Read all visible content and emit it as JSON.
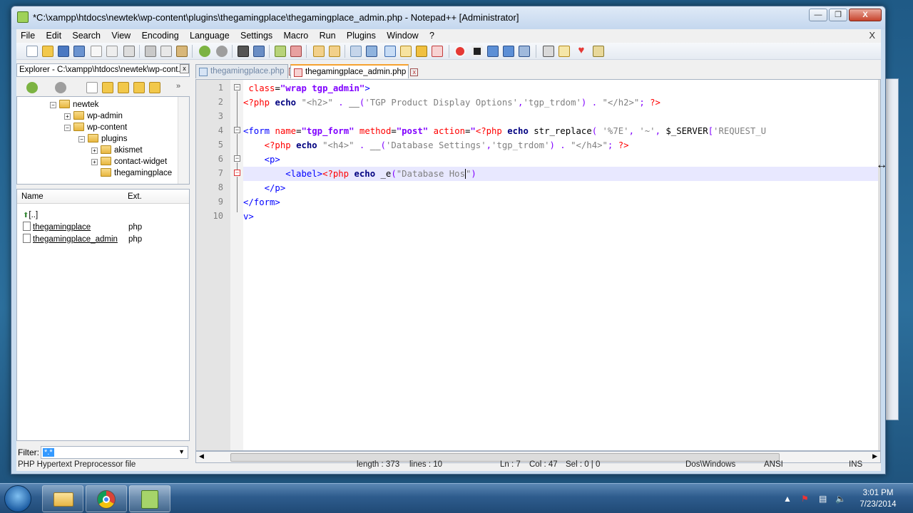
{
  "window": {
    "title": "*C:\\xampp\\htdocs\\newtek\\wp-content\\plugins\\thegamingplace\\thegamingplace_admin.php - Notepad++ [Administrator]",
    "min_label": "—",
    "max_label": "❐",
    "close_label": "X"
  },
  "menu": {
    "items": [
      "File",
      "Edit",
      "Search",
      "View",
      "Encoding",
      "Language",
      "Settings",
      "Macro",
      "Run",
      "Plugins",
      "Window",
      "?"
    ],
    "close_label": "X"
  },
  "explorer": {
    "title": "Explorer - C:\\xampp\\htdocs\\newtek\\wp-cont...",
    "close_label": "x",
    "tree": [
      {
        "label": "newtek",
        "expander": "−"
      },
      {
        "label": "wp-admin",
        "expander": "+"
      },
      {
        "label": "wp-content",
        "expander": "−"
      },
      {
        "label": "plugins",
        "expander": "−"
      },
      {
        "label": "akismet",
        "expander": "+"
      },
      {
        "label": "contact-widget",
        "expander": "+"
      },
      {
        "label": "thegamingplace",
        "expander": ""
      }
    ],
    "file_columns": {
      "name": "Name",
      "ext": "Ext."
    },
    "files": [
      {
        "name": "[..]",
        "ext": ""
      },
      {
        "name": "thegamingplace",
        "ext": "php"
      },
      {
        "name": "thegamingplace_admin",
        "ext": "php"
      }
    ],
    "filter_label": "Filter:",
    "filter_value": "*.*"
  },
  "tabs": [
    {
      "label": "thegamingplace.php",
      "active": false
    },
    {
      "label": "thegamingplace_admin.php",
      "active": true
    }
  ],
  "editor": {
    "line_numbers": [
      "1",
      "2",
      "3",
      "4",
      "5",
      "6",
      "7",
      "8",
      "9",
      "10"
    ]
  },
  "status": {
    "file_type": "PHP Hypertext Preprocessor file",
    "length": "length : 373",
    "lines": "lines : 10",
    "ln": "Ln : 7",
    "col": "Col : 47",
    "sel": "Sel : 0 | 0",
    "eol": "Dos\\Windows",
    "encoding": "ANSI",
    "mode": "INS"
  },
  "taskbar": {
    "time": "3:01 PM",
    "date": "7/23/2014"
  },
  "icons": [
    "windows-start-icon",
    "folder-icon",
    "chrome-icon",
    "notepadpp-icon",
    "flag-icon",
    "network-icon",
    "volume-icon",
    "resize-cursor-icon"
  ]
}
